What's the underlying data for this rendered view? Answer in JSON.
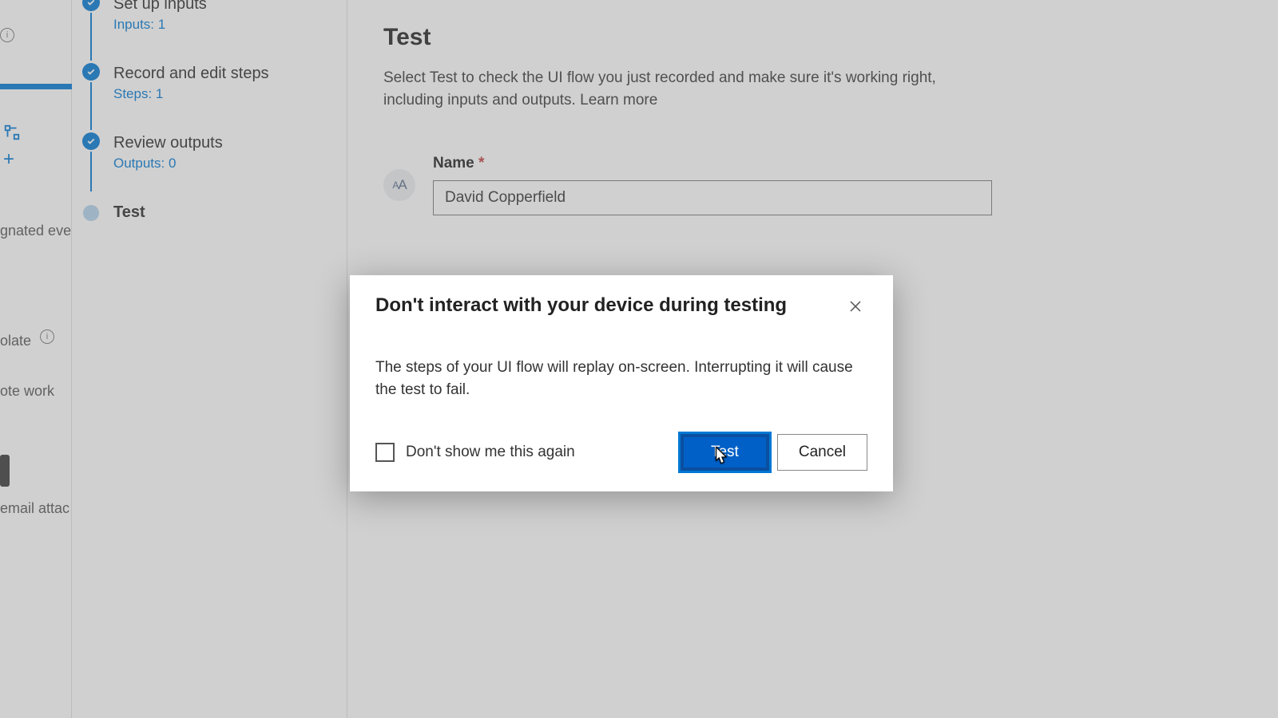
{
  "left_rail": {
    "txt_events": "gnated even",
    "txt_template": "olate",
    "txt_work": "ote work",
    "txt_attach": "email attac"
  },
  "steps": {
    "s1": {
      "title": "Set up inputs",
      "sub": "Inputs: 1"
    },
    "s2": {
      "title": "Record and edit steps",
      "sub": "Steps: 1"
    },
    "s3": {
      "title": "Review outputs",
      "sub": "Outputs: 0"
    },
    "s4": {
      "title": "Test"
    }
  },
  "main": {
    "heading": "Test",
    "description": "Select Test to check the UI flow you just recorded and make sure it's working right, including inputs and outputs. ",
    "learn_more": "Learn more",
    "field_label": "Name ",
    "field_required": "*",
    "field_value": "David Copperfield"
  },
  "dialog": {
    "title": "Don't interact with your device during testing",
    "body": "The steps of your UI flow will replay on-screen. Interrupting it will cause the test to fail.",
    "checkbox_label": "Don't show me this again",
    "primary_label": "Test",
    "cancel_label": "Cancel"
  }
}
